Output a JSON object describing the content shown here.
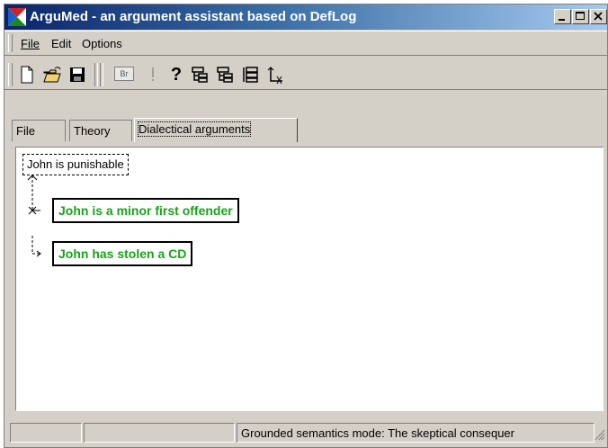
{
  "window": {
    "title": "ArguMed - an argument assistant based on DefLog"
  },
  "menu": {
    "file": "File",
    "edit": "Edit",
    "options": "Options"
  },
  "toolbar": {
    "br_label": "Br",
    "help_label": "?"
  },
  "tabs": [
    {
      "label": "File"
    },
    {
      "label": "Theory"
    },
    {
      "label": "Dialectical arguments"
    }
  ],
  "tree": {
    "root": "John is punishable",
    "reasons": [
      "John is a minor first offender",
      "John has stolen a CD"
    ],
    "reason_color": "#1aa31a"
  },
  "status": {
    "cell1": "",
    "cell2": "",
    "message": "Grounded semantics mode: The skeptical consequer"
  }
}
